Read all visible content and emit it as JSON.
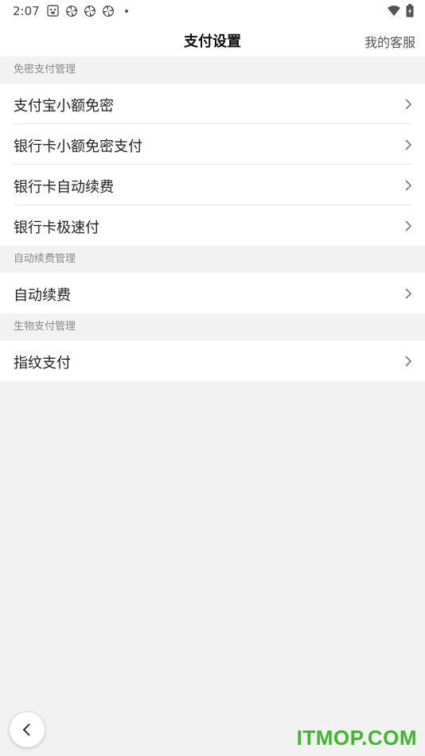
{
  "status_bar": {
    "time": "2:07",
    "icons": [
      "baidu-icon",
      "pinwheel-icon",
      "pinwheel-icon",
      "pinwheel-icon",
      "dot-icon"
    ],
    "right_icons": [
      "wifi-icon",
      "battery-charging-icon"
    ]
  },
  "nav": {
    "title": "支付设置",
    "action": "我的客服"
  },
  "sections": [
    {
      "header": "免密支付管理",
      "items": [
        {
          "label": "支付宝小额免密"
        },
        {
          "label": "银行卡小额免密支付"
        },
        {
          "label": "银行卡自动续费"
        },
        {
          "label": "银行卡极速付"
        }
      ]
    },
    {
      "header": "自动续费管理",
      "items": [
        {
          "label": "自动续费"
        }
      ]
    },
    {
      "header": "生物支付管理",
      "items": [
        {
          "label": "指纹支付"
        }
      ]
    }
  ],
  "watermark": "ITMOP.COM",
  "colors": {
    "background": "#f2f2f2",
    "card": "#ffffff",
    "watermark": "#3db92b"
  }
}
